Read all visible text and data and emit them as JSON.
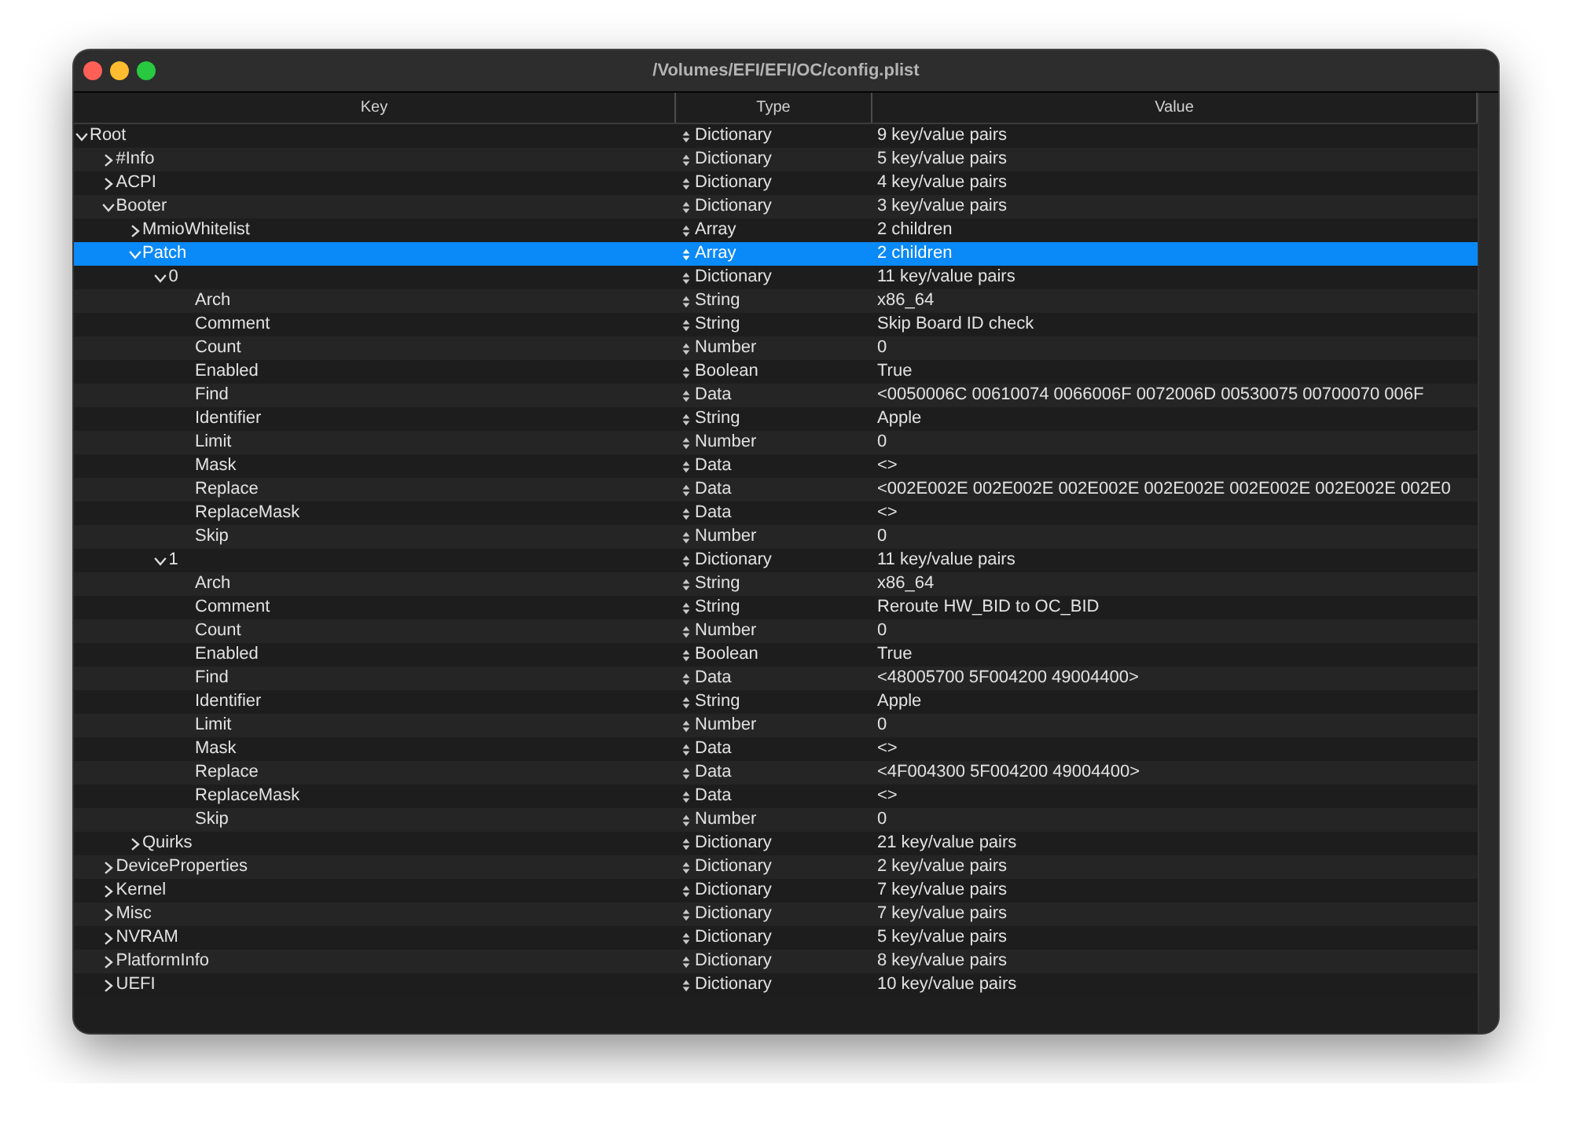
{
  "window": {
    "title": "/Volumes/EFI/EFI/OC/config.plist"
  },
  "columns": [
    "Key",
    "Type",
    "Value"
  ],
  "tree": [
    {
      "key": "Root",
      "type": "Dictionary",
      "value": "9 key/value pairs",
      "expanded": true,
      "selected": false,
      "children": [
        {
          "key": "#Info",
          "type": "Dictionary",
          "value": "5 key/value pairs",
          "expanded": false,
          "selected": false
        },
        {
          "key": "ACPI",
          "type": "Dictionary",
          "value": "4 key/value pairs",
          "expanded": false,
          "selected": false
        },
        {
          "key": "Booter",
          "type": "Dictionary",
          "value": "3 key/value pairs",
          "expanded": true,
          "selected": false,
          "children": [
            {
              "key": "MmioWhitelist",
              "type": "Array",
              "value": "2 children",
              "expanded": false,
              "selected": false
            },
            {
              "key": "Patch",
              "type": "Array",
              "value": "2 children",
              "expanded": true,
              "selected": true,
              "children": [
                {
                  "key": "0",
                  "type": "Dictionary",
                  "value": "11 key/value pairs",
                  "expanded": true,
                  "selected": false,
                  "children": [
                    {
                      "key": "Arch",
                      "type": "String",
                      "value": "x86_64",
                      "selected": false
                    },
                    {
                      "key": "Comment",
                      "type": "String",
                      "value": "Skip Board ID check",
                      "selected": false
                    },
                    {
                      "key": "Count",
                      "type": "Number",
                      "value": "0",
                      "selected": false
                    },
                    {
                      "key": "Enabled",
                      "type": "Boolean",
                      "value": "True",
                      "selected": false
                    },
                    {
                      "key": "Find",
                      "type": "Data",
                      "value": "<0050006C 00610074 0066006F 0072006D 00530075 00700070 006F",
                      "selected": false
                    },
                    {
                      "key": "Identifier",
                      "type": "String",
                      "value": "Apple",
                      "selected": false
                    },
                    {
                      "key": "Limit",
                      "type": "Number",
                      "value": "0",
                      "selected": false
                    },
                    {
                      "key": "Mask",
                      "type": "Data",
                      "value": "<>",
                      "selected": false
                    },
                    {
                      "key": "Replace",
                      "type": "Data",
                      "value": "<002E002E 002E002E 002E002E 002E002E 002E002E 002E002E 002E0",
                      "selected": false
                    },
                    {
                      "key": "ReplaceMask",
                      "type": "Data",
                      "value": "<>",
                      "selected": false
                    },
                    {
                      "key": "Skip",
                      "type": "Number",
                      "value": "0",
                      "selected": false
                    }
                  ]
                },
                {
                  "key": "1",
                  "type": "Dictionary",
                  "value": "11 key/value pairs",
                  "expanded": true,
                  "selected": false,
                  "children": [
                    {
                      "key": "Arch",
                      "type": "String",
                      "value": "x86_64",
                      "selected": false
                    },
                    {
                      "key": "Comment",
                      "type": "String",
                      "value": "Reroute HW_BID to OC_BID",
                      "selected": false
                    },
                    {
                      "key": "Count",
                      "type": "Number",
                      "value": "0",
                      "selected": false
                    },
                    {
                      "key": "Enabled",
                      "type": "Boolean",
                      "value": "True",
                      "selected": false
                    },
                    {
                      "key": "Find",
                      "type": "Data",
                      "value": "<48005700 5F004200 49004400>",
                      "selected": false
                    },
                    {
                      "key": "Identifier",
                      "type": "String",
                      "value": "Apple",
                      "selected": false
                    },
                    {
                      "key": "Limit",
                      "type": "Number",
                      "value": "0",
                      "selected": false
                    },
                    {
                      "key": "Mask",
                      "type": "Data",
                      "value": "<>",
                      "selected": false
                    },
                    {
                      "key": "Replace",
                      "type": "Data",
                      "value": "<4F004300 5F004200 49004400>",
                      "selected": false
                    },
                    {
                      "key": "ReplaceMask",
                      "type": "Data",
                      "value": "<>",
                      "selected": false
                    },
                    {
                      "key": "Skip",
                      "type": "Number",
                      "value": "0",
                      "selected": false
                    }
                  ]
                }
              ]
            },
            {
              "key": "Quirks",
              "type": "Dictionary",
              "value": "21 key/value pairs",
              "expanded": false,
              "selected": false
            }
          ]
        },
        {
          "key": "DeviceProperties",
          "type": "Dictionary",
          "value": "2 key/value pairs",
          "expanded": false,
          "selected": false
        },
        {
          "key": "Kernel",
          "type": "Dictionary",
          "value": "7 key/value pairs",
          "expanded": false,
          "selected": false
        },
        {
          "key": "Misc",
          "type": "Dictionary",
          "value": "7 key/value pairs",
          "expanded": false,
          "selected": false
        },
        {
          "key": "NVRAM",
          "type": "Dictionary",
          "value": "5 key/value pairs",
          "expanded": false,
          "selected": false
        },
        {
          "key": "PlatformInfo",
          "type": "Dictionary",
          "value": "8 key/value pairs",
          "expanded": false,
          "selected": false
        },
        {
          "key": "UEFI",
          "type": "Dictionary",
          "value": "10 key/value pairs",
          "expanded": false,
          "selected": false
        }
      ]
    }
  ]
}
